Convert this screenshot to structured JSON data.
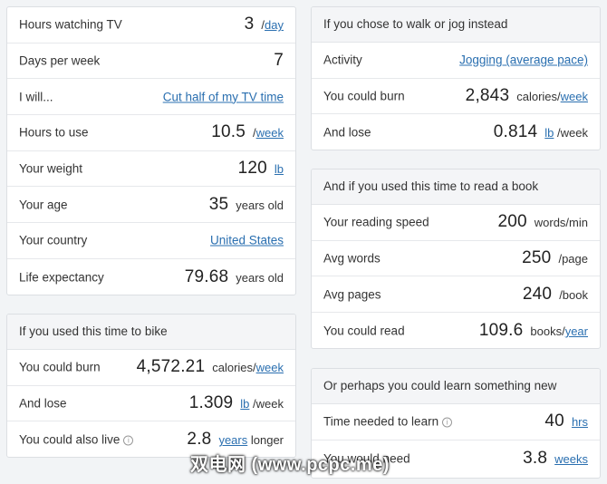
{
  "tv": {
    "hours_label": "Hours watching TV",
    "hours_value": "3",
    "hours_sep": "/",
    "hours_unit": "day",
    "days_label": "Days per week",
    "days_value": "7",
    "will_label": "I will...",
    "will_value": "Cut half of my TV time",
    "use_label": "Hours to use",
    "use_value": "10.5",
    "use_sep": "/",
    "use_unit": "week",
    "weight_label": "Your weight",
    "weight_value": "120",
    "weight_unit": "lb",
    "age_label": "Your age",
    "age_value": "35",
    "age_unit": "years old",
    "country_label": "Your country",
    "country_value": "United States",
    "life_label": "Life expectancy",
    "life_value": "79.68",
    "life_unit": "years old"
  },
  "bike": {
    "title": "If you used this time to bike",
    "burn_label": "You could burn",
    "burn_value": "4,572.21",
    "burn_unit_prefix": "calories/",
    "burn_unit_link": "week",
    "lose_label": "And lose",
    "lose_value": "1.309",
    "lose_unit_link": "lb",
    "lose_unit_suffix": "/week",
    "live_label": "You could also live",
    "live_value": "2.8",
    "live_unit_link": "years",
    "live_unit_suffix": "longer"
  },
  "walk": {
    "title": "If you chose to walk or jog instead",
    "activity_label": "Activity",
    "activity_value": "Jogging (average pace)",
    "burn_label": "You could burn",
    "burn_value": "2,843",
    "burn_unit_prefix": "calories/",
    "burn_unit_link": "week",
    "lose_label": "And lose",
    "lose_value": "0.814",
    "lose_unit_link": "lb",
    "lose_unit_suffix": "/week"
  },
  "book": {
    "title": "And if you used this time to read a book",
    "speed_label": "Your reading speed",
    "speed_value": "200",
    "speed_unit": "words/min",
    "words_label": "Avg words",
    "words_value": "250",
    "words_unit": "/page",
    "pages_label": "Avg pages",
    "pages_value": "240",
    "pages_unit": "/book",
    "read_label": "You could read",
    "read_value": "109.6",
    "read_unit_prefix": "books/",
    "read_unit_link": "year"
  },
  "learn": {
    "title": "Or perhaps you could learn something new",
    "time_label": "Time needed to learn",
    "time_value": "40",
    "time_unit_link": "hrs",
    "need_label": "You would need",
    "need_value": "3.8",
    "need_unit_link": "weeks"
  },
  "watermark": "双电网 (www.pcpc.me)",
  "info_glyph": "i"
}
